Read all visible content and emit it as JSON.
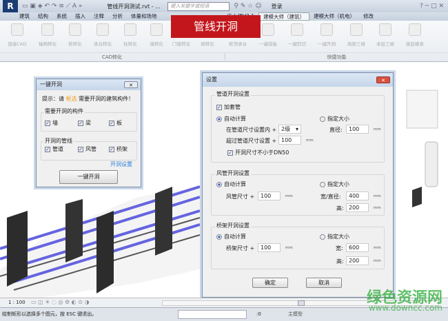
{
  "titlebar": {
    "doc_title": "管线开洞测试.rvt - ...",
    "search_placeholder": "键入关键字或短语",
    "login": "登录"
  },
  "tabs": [
    "建筑",
    "结构",
    "系统",
    "插入",
    "注释",
    "分析",
    "体量和场地",
    "库大师V2.1",
    "建模大师（建筑）",
    "建模大师（机电）",
    "修改"
  ],
  "banner": "管线开洞",
  "ribbon": {
    "cad_buttons": [
      "链接CAD",
      "轴网转化",
      "桩转化",
      "承台转化",
      "柱转化",
      "墙转化",
      "门窗转化",
      "梁转化"
    ],
    "cad_group": "CAD转化",
    "quick_buttons": [
      "桩顶承台",
      "一键成板",
      "一键剪切",
      "一键开洞",
      "局部三维",
      "本层三维",
      "拔层楼表"
    ],
    "quick_group": "快捷功能"
  },
  "oneclick": {
    "title": "一键开洞",
    "hint_prefix": "提示：请",
    "hint_highlight": "框选",
    "hint_suffix": "需要开洞的建筑构件！",
    "group1": "需要开洞的构件",
    "g1_items": [
      "墙",
      "梁",
      "板"
    ],
    "group2": "开洞的管线",
    "g2_items": [
      "管道",
      "风管",
      "桥架"
    ],
    "settings_link": "开洞设置",
    "run_button": "一键开洞"
  },
  "settings": {
    "title": "设置",
    "pipe": {
      "legend": "管道开洞设置",
      "sleeve": "加套管",
      "auto": "自动计算",
      "inside_label": "在管道尺寸设置内 +",
      "inside_value": "2级",
      "over_label": "超过管道尺寸设置 +",
      "over_value": "100",
      "min_dn": "开洞尺寸不小于DN50",
      "fixed": "指定大小",
      "dia_label": "直径:",
      "dia_value": "100"
    },
    "duct": {
      "legend": "风管开洞设置",
      "auto": "自动计算",
      "size_label": "风管尺寸 +",
      "size_value": "100",
      "fixed": "指定大小",
      "w_label": "宽/直径:",
      "w_value": "400",
      "h_label": "高:",
      "h_value": "200"
    },
    "tray": {
      "legend": "桥架开洞设置",
      "auto": "自动计算",
      "size_label": "桥架尺寸 +",
      "size_value": "100",
      "fixed": "指定大小",
      "w_label": "宽:",
      "w_value": "600",
      "h_label": "高:",
      "h_value": "200"
    },
    "unit": "mm",
    "ok": "确定",
    "cancel": "取消"
  },
  "viewbar": {
    "scale": "1 : 100"
  },
  "status": {
    "message": "绘制矩形以选择多个图元，按 ESC 键退出。",
    "count": ":0",
    "model": "主模型"
  },
  "watermark": {
    "line1": "绿色资源网",
    "line2": "www.downcc.com"
  },
  "colors": {
    "banner": "#c3161c",
    "pipe": "#5a5ad8",
    "link": "#2a7fd4",
    "highlight": "#f0a020"
  }
}
